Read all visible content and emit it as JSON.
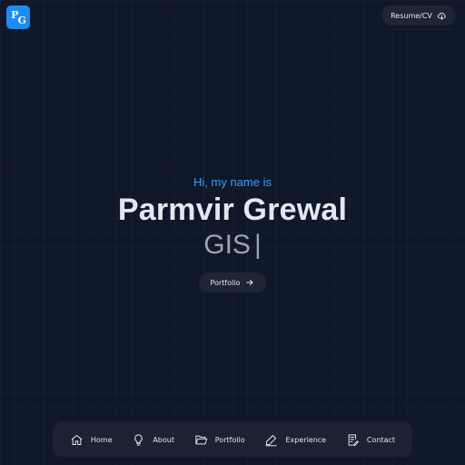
{
  "logo": {
    "letters_1": "P",
    "letters_2": "G"
  },
  "header": {
    "resume_label": "Resume/CV",
    "resume_icon": "cloud-download-icon"
  },
  "hero": {
    "greeting": "Hi, my name is",
    "name": "Parmvir Grewal",
    "role": "GIS",
    "cursor": "|",
    "portfolio_label": "Portfolio",
    "portfolio_icon": "arrow-right-icon"
  },
  "nav": {
    "items": [
      {
        "label": "Home",
        "icon": "home-icon"
      },
      {
        "label": "About",
        "icon": "lightbulb-icon"
      },
      {
        "label": "Portfolio",
        "icon": "folder-open-icon"
      },
      {
        "label": "Experience",
        "icon": "pencil-icon"
      },
      {
        "label": "Contact",
        "icon": "contact-form-icon"
      }
    ]
  },
  "colors": {
    "background": "#0f172a",
    "accent": "#38a3f5",
    "logo": "#1d8cf0",
    "button_bg": "#1e2636",
    "nav_bg": "#1a2233"
  }
}
